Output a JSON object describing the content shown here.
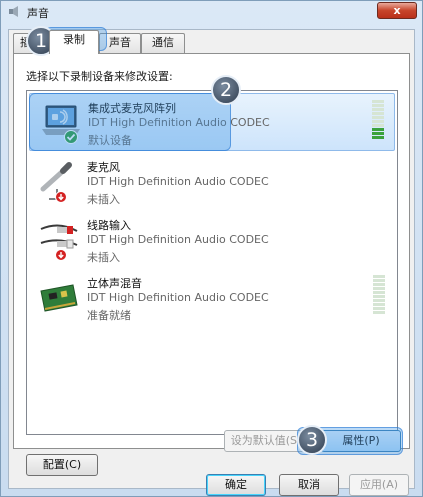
{
  "window": {
    "title": "声音",
    "close_label": "x"
  },
  "tabs": [
    {
      "label": "播放",
      "active": false
    },
    {
      "label": "录制",
      "active": true
    },
    {
      "label": "声音",
      "active": false
    },
    {
      "label": "通信",
      "active": false
    }
  ],
  "instruction": "选择以下录制设备来修改设置:",
  "devices": [
    {
      "name": "集成式麦克风阵列",
      "driver": "IDT High Definition Audio CODEC",
      "status": "默认设备",
      "icon": "microphone-array-icon",
      "level": 0.3
    },
    {
      "name": "麦克风",
      "driver": "IDT High Definition Audio CODEC",
      "status": "未插入",
      "icon": "microphone-icon"
    },
    {
      "name": "线路输入",
      "driver": "IDT High Definition Audio CODEC",
      "status": "未插入",
      "icon": "line-in-icon"
    },
    {
      "name": "立体声混音",
      "driver": "IDT High Definition Audio CODEC",
      "status": "准备就绪",
      "icon": "sound-card-icon",
      "level": 0
    }
  ],
  "buttons": {
    "configure": "配置(C)",
    "set_default": "设为默认值(S)",
    "properties": "属性(P)",
    "ok": "确定",
    "cancel": "取消",
    "apply": "应用(A)"
  },
  "callouts": [
    "1",
    "2",
    "3"
  ],
  "colors": {
    "accent": "#3c96e6",
    "level_on": "#3aa23c",
    "status_default": "#2e9b3a",
    "status_unplugged": "#d42222"
  }
}
